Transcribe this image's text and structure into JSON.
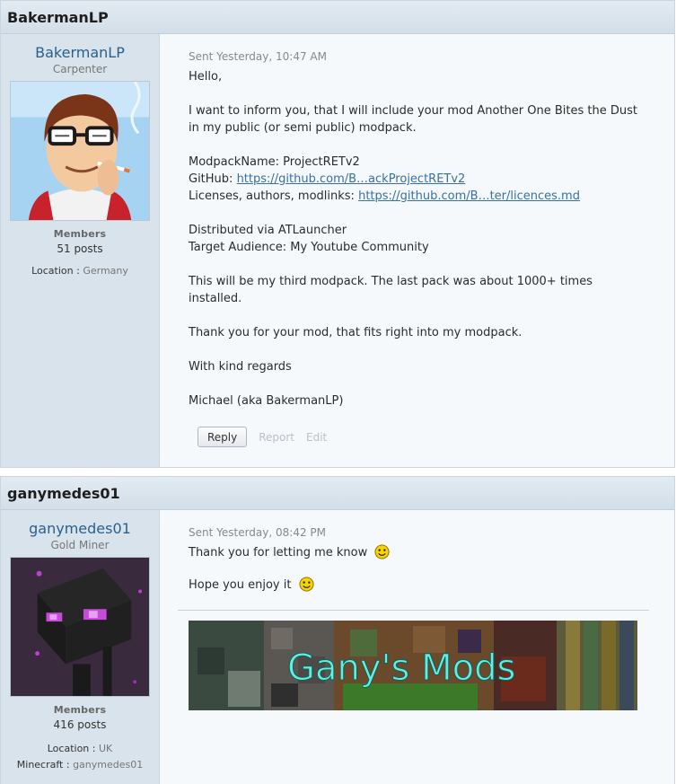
{
  "posts": [
    {
      "header": "BakermanLP",
      "author": {
        "name": "BakermanLP",
        "rank": "Carpenter",
        "group": "Members",
        "posts": "51 posts",
        "location_key": "Location :",
        "location_val": "Germany"
      },
      "sent": "Sent Yesterday, 10:47 AM",
      "greeting": "Hello,",
      "para1": "I want to inform you, that I will include your mod Another One Bites the Dust\nin my public (or semi public) modpack.",
      "modpack_line": "ModpackName: ProjectRETv2",
      "github_label": "GitHub: ",
      "github_link": "https://github.com/B…ackProjectRETv2",
      "licenses_label": "Licenses, authors, modlinks: ",
      "licenses_link": "https://github.com/B…ter/licences.md",
      "distributed": "Distributed via ATLauncher",
      "audience": "Target Audience: My Youtube Community",
      "third": "This will be my third modpack. The last pack was about 1000+ times\ninstalled.",
      "thanks": "Thank you for your mod, that fits right into my modpack.",
      "regards": "With kind regards",
      "signature": "Michael (aka BakermanLP)",
      "actions": {
        "reply": "Reply",
        "report": "Report",
        "edit": "Edit"
      }
    },
    {
      "header": "ganymedes01",
      "author": {
        "name": "ganymedes01",
        "rank": "Gold Miner",
        "group": "Members",
        "posts": "416 posts",
        "location_key": "Location :",
        "location_val": "UK",
        "minecraft_key": "Minecraft :",
        "minecraft_val": "ganymedes01"
      },
      "sent": "Sent Yesterday, 08:42 PM",
      "line1": "Thank you for letting me know",
      "line2": "Hope you enjoy it",
      "banner_text": "Gany's Mods"
    }
  ],
  "colors": {
    "link": "#3570a8",
    "author_name": "#2a5f8c",
    "sidebar": "#d8e3ec"
  },
  "icons": [
    "smiley-icon",
    "smiley-icon"
  ]
}
